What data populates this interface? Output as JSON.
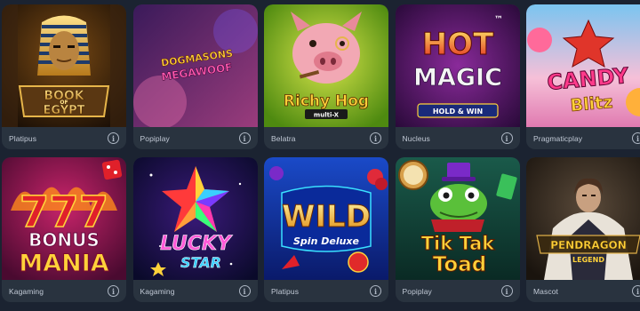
{
  "games": [
    {
      "title": "BOOK OF EGYPT",
      "line1": "BOOK",
      "line2": "OF",
      "line3": "EGYPT",
      "provider": "Platipus"
    },
    {
      "title": "DOGMASONS MEGAWOOF",
      "line1": "DOGMASONS",
      "line2": "MEGAWOOF",
      "provider": "Popiplay"
    },
    {
      "title": "Richy Hog multi-X",
      "line1": "Richy Hog",
      "line2": "multi-X",
      "provider": "Belatra"
    },
    {
      "title": "HOT MAGIC HOLD & WIN",
      "line1": "HOT",
      "line2": "MAGIC",
      "line3": "HOLD & WIN",
      "mark": "™",
      "provider": "Nucleus"
    },
    {
      "title": "CANDY BLITZ",
      "line1": "CANDY",
      "line2": "Blitz",
      "provider": "Pragmaticplay"
    },
    {
      "title": "777 BONUS MANIA",
      "line1": "777",
      "line2": "BONUS",
      "line3": "MANIA",
      "provider": "Kagaming"
    },
    {
      "title": "LUCKY STAR",
      "line1": "LUCKY",
      "line2": "STAR",
      "provider": "Kagaming"
    },
    {
      "title": "WILD Spin Deluxe",
      "line1": "WILD",
      "line2": "Spin Deluxe",
      "provider": "Platipus"
    },
    {
      "title": "Tik Tak Toad",
      "line1": "Tik Tak",
      "line2": "Toad",
      "provider": "Popiplay"
    },
    {
      "title": "PENDRAGON LEGEND",
      "line1": "PENDRAGON",
      "line2": "LEGEND",
      "provider": "Mascot"
    }
  ],
  "info_glyph": "i",
  "icons": {
    "info": "info-circle-icon"
  },
  "colors": {
    "page_bg": "#1b2331",
    "card_bg": "#29333f",
    "provider_text": "#c2cad6"
  }
}
